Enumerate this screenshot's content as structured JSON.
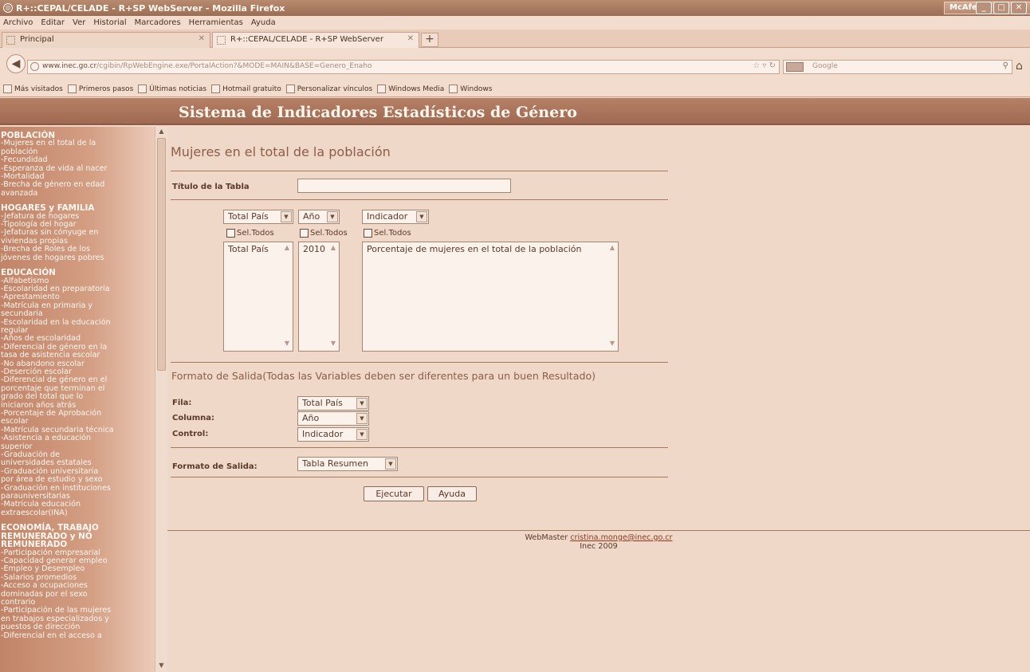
{
  "window": {
    "title": "R+::CEPAL/CELADE - R+SP WebServer - Mozilla Firefox",
    "mcafee": "McAfee"
  },
  "menu": [
    "Archivo",
    "Editar",
    "Ver",
    "Historial",
    "Marcadores",
    "Herramientas",
    "Ayuda"
  ],
  "tabs": [
    {
      "label": "Principal"
    },
    {
      "label": "R+::CEPAL/CELADE - R+SP WebServer"
    }
  ],
  "nav": {
    "url_host": "www.inec.go.cr",
    "url_path": "/cgibin/RpWebEngine.exe/PortalAction?&MODE=MAIN&BASE=Genero_Enaho",
    "search_placeholder": "Google"
  },
  "bookmarks": [
    "Más visitados",
    "Primeros pasos",
    "Últimas noticias",
    "Hotmail gratuito",
    "Personalizar vínculos",
    "Windows Media",
    "Windows"
  ],
  "header": {
    "title": "Sistema de Indicadores Estadísticos de Género"
  },
  "sidebar": {
    "sections": [
      {
        "heading": "POBLACIÓN",
        "items": [
          "-Mujeres en el total de la",
          "población",
          "-Fecundidad",
          "-Esperanza de vida al nacer",
          "-Mortalidad",
          "-Brecha de género en edad",
          "avanzada"
        ]
      },
      {
        "heading": "HOGARES y FAMILIA",
        "items": [
          "-Jefatura de hogares",
          "-Tipología del hogar",
          "-Jefaturas sin cónyuge en",
          "viviendas propias",
          "-Brecha de Roles de los",
          "jóvenes de hogares pobres"
        ]
      },
      {
        "heading": "EDUCACIÓN",
        "items": [
          "-Alfabetismo",
          "-Escolaridad en preparatoria",
          "-Aprestamiento",
          "-Matrícula en primaria y",
          "secundaria",
          "-Escolaridad en la educación",
          "regular",
          "-Años de escolaridad",
          "-Diferencial de género en la",
          "tasa de asistencia escolar",
          "-No abandono escolar",
          "-Deserción escolar",
          "-Diferencial de género en el",
          "porcentaje que terminan el",
          "grado del total que lo",
          "iniciaron años atrás",
          "-Porcentaje de Aprobación",
          "escolar",
          "-Matrícula secundaria técnica",
          "-Asistencia a educación",
          "superior",
          "-Graduación de",
          "universidades estatales",
          "-Graduación universitaria",
          "por área de estudio y sexo",
          "-Graduación en instituciones",
          "parauniversitarias",
          "-Matrícula educación",
          "extraescolar(INA)"
        ]
      },
      {
        "heading": "ECONOMÍA, TRABAJO REMUNERADO y NO REMUNERADO",
        "items": [
          "-Participación empresarial",
          "-Capacidad generar empleo",
          "-Empleo y Desempleo",
          "-Salarios promedios",
          "-Acceso a ocupaciones",
          "dominadas por el sexo",
          "contrario",
          "-Participación de las mujeres",
          "en trabajos especializados y",
          "puestos de dirección",
          "-Diferencial en el acceso a"
        ]
      }
    ]
  },
  "main": {
    "page_title": "Mujeres en el total de la población",
    "table_title_label": "Título de la Tabla",
    "table_title_value": "",
    "selectors": [
      {
        "selected": "Total País",
        "check_label": "Sel.Todos",
        "list_items": [
          "Total País"
        ]
      },
      {
        "selected": "Año",
        "check_label": "Sel.Todos",
        "list_items": [
          "2010"
        ]
      },
      {
        "selected": "Indicador",
        "check_label": "Sel.Todos",
        "list_items": [
          "Porcentaje de mujeres en el total de la población"
        ]
      }
    ],
    "output_section_title": "Formato de Salida(Todas las Variables deben ser diferentes para un buen Resultado)",
    "fila_label": "Fila:",
    "fila_value": "Total País",
    "columna_label": "Columna:",
    "columna_value": "Año",
    "control_label": "Control:",
    "control_value": "Indicador",
    "formato_label": "Formato de Salida:",
    "formato_value": "Tabla Resumen",
    "run_button": "Ejecutar",
    "help_button": "Ayuda",
    "footer_prefix": "WebMaster",
    "footer_email": "cristina.monge@inec.go.cr",
    "footer_year": "Inec 2009"
  }
}
